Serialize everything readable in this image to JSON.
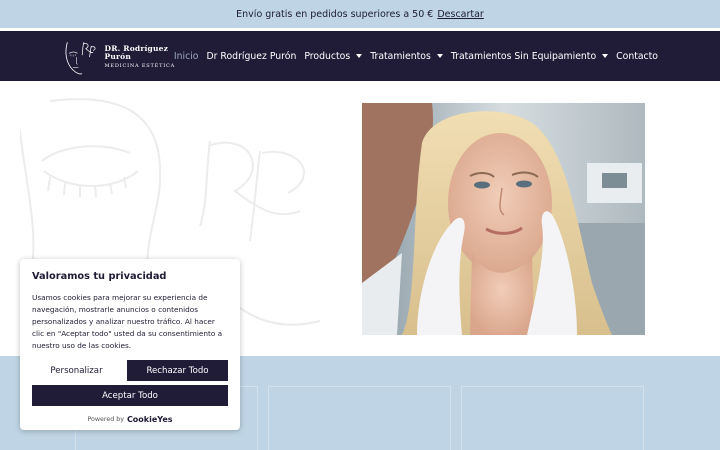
{
  "announcement": {
    "text": "Envío gratis en pedidos superiores a 50 €",
    "dismiss_label": "Descartar"
  },
  "logo": {
    "monogram": "Rp",
    "name": "DR. Rodríguez Purón",
    "tagline": "MEDICINA ESTÉTICA"
  },
  "nav": {
    "items": [
      {
        "label": "Inicio",
        "active": true,
        "dropdown": false
      },
      {
        "label": "Dr Rodríguez Purón",
        "dropdown": false
      },
      {
        "label": "Productos",
        "dropdown": true
      },
      {
        "label": "Tratamientos",
        "dropdown": true
      },
      {
        "label": "Tratamientos Sin Equipamiento",
        "dropdown": true
      },
      {
        "label": "Contacto",
        "dropdown": false
      }
    ]
  },
  "cookie": {
    "title": "Valoramos tu privacidad",
    "body": "Usamos cookies para mejorar su experiencia de navegación, mostrarle anuncios o contenidos personalizados y analizar nuestro tráfico. Al hacer clic en \"Aceptar todo\" usted da su consentimiento a nuestro uso de las cookies.",
    "customize_label": "Personalizar",
    "reject_label": "Rechazar Todo",
    "accept_label": "Aceptar Todo",
    "powered_by": "Powered by",
    "powered_brand": "CookieYes"
  },
  "colors": {
    "navy": "#201c38",
    "light_blue": "#bfd5e5",
    "white": "#ffffff"
  }
}
